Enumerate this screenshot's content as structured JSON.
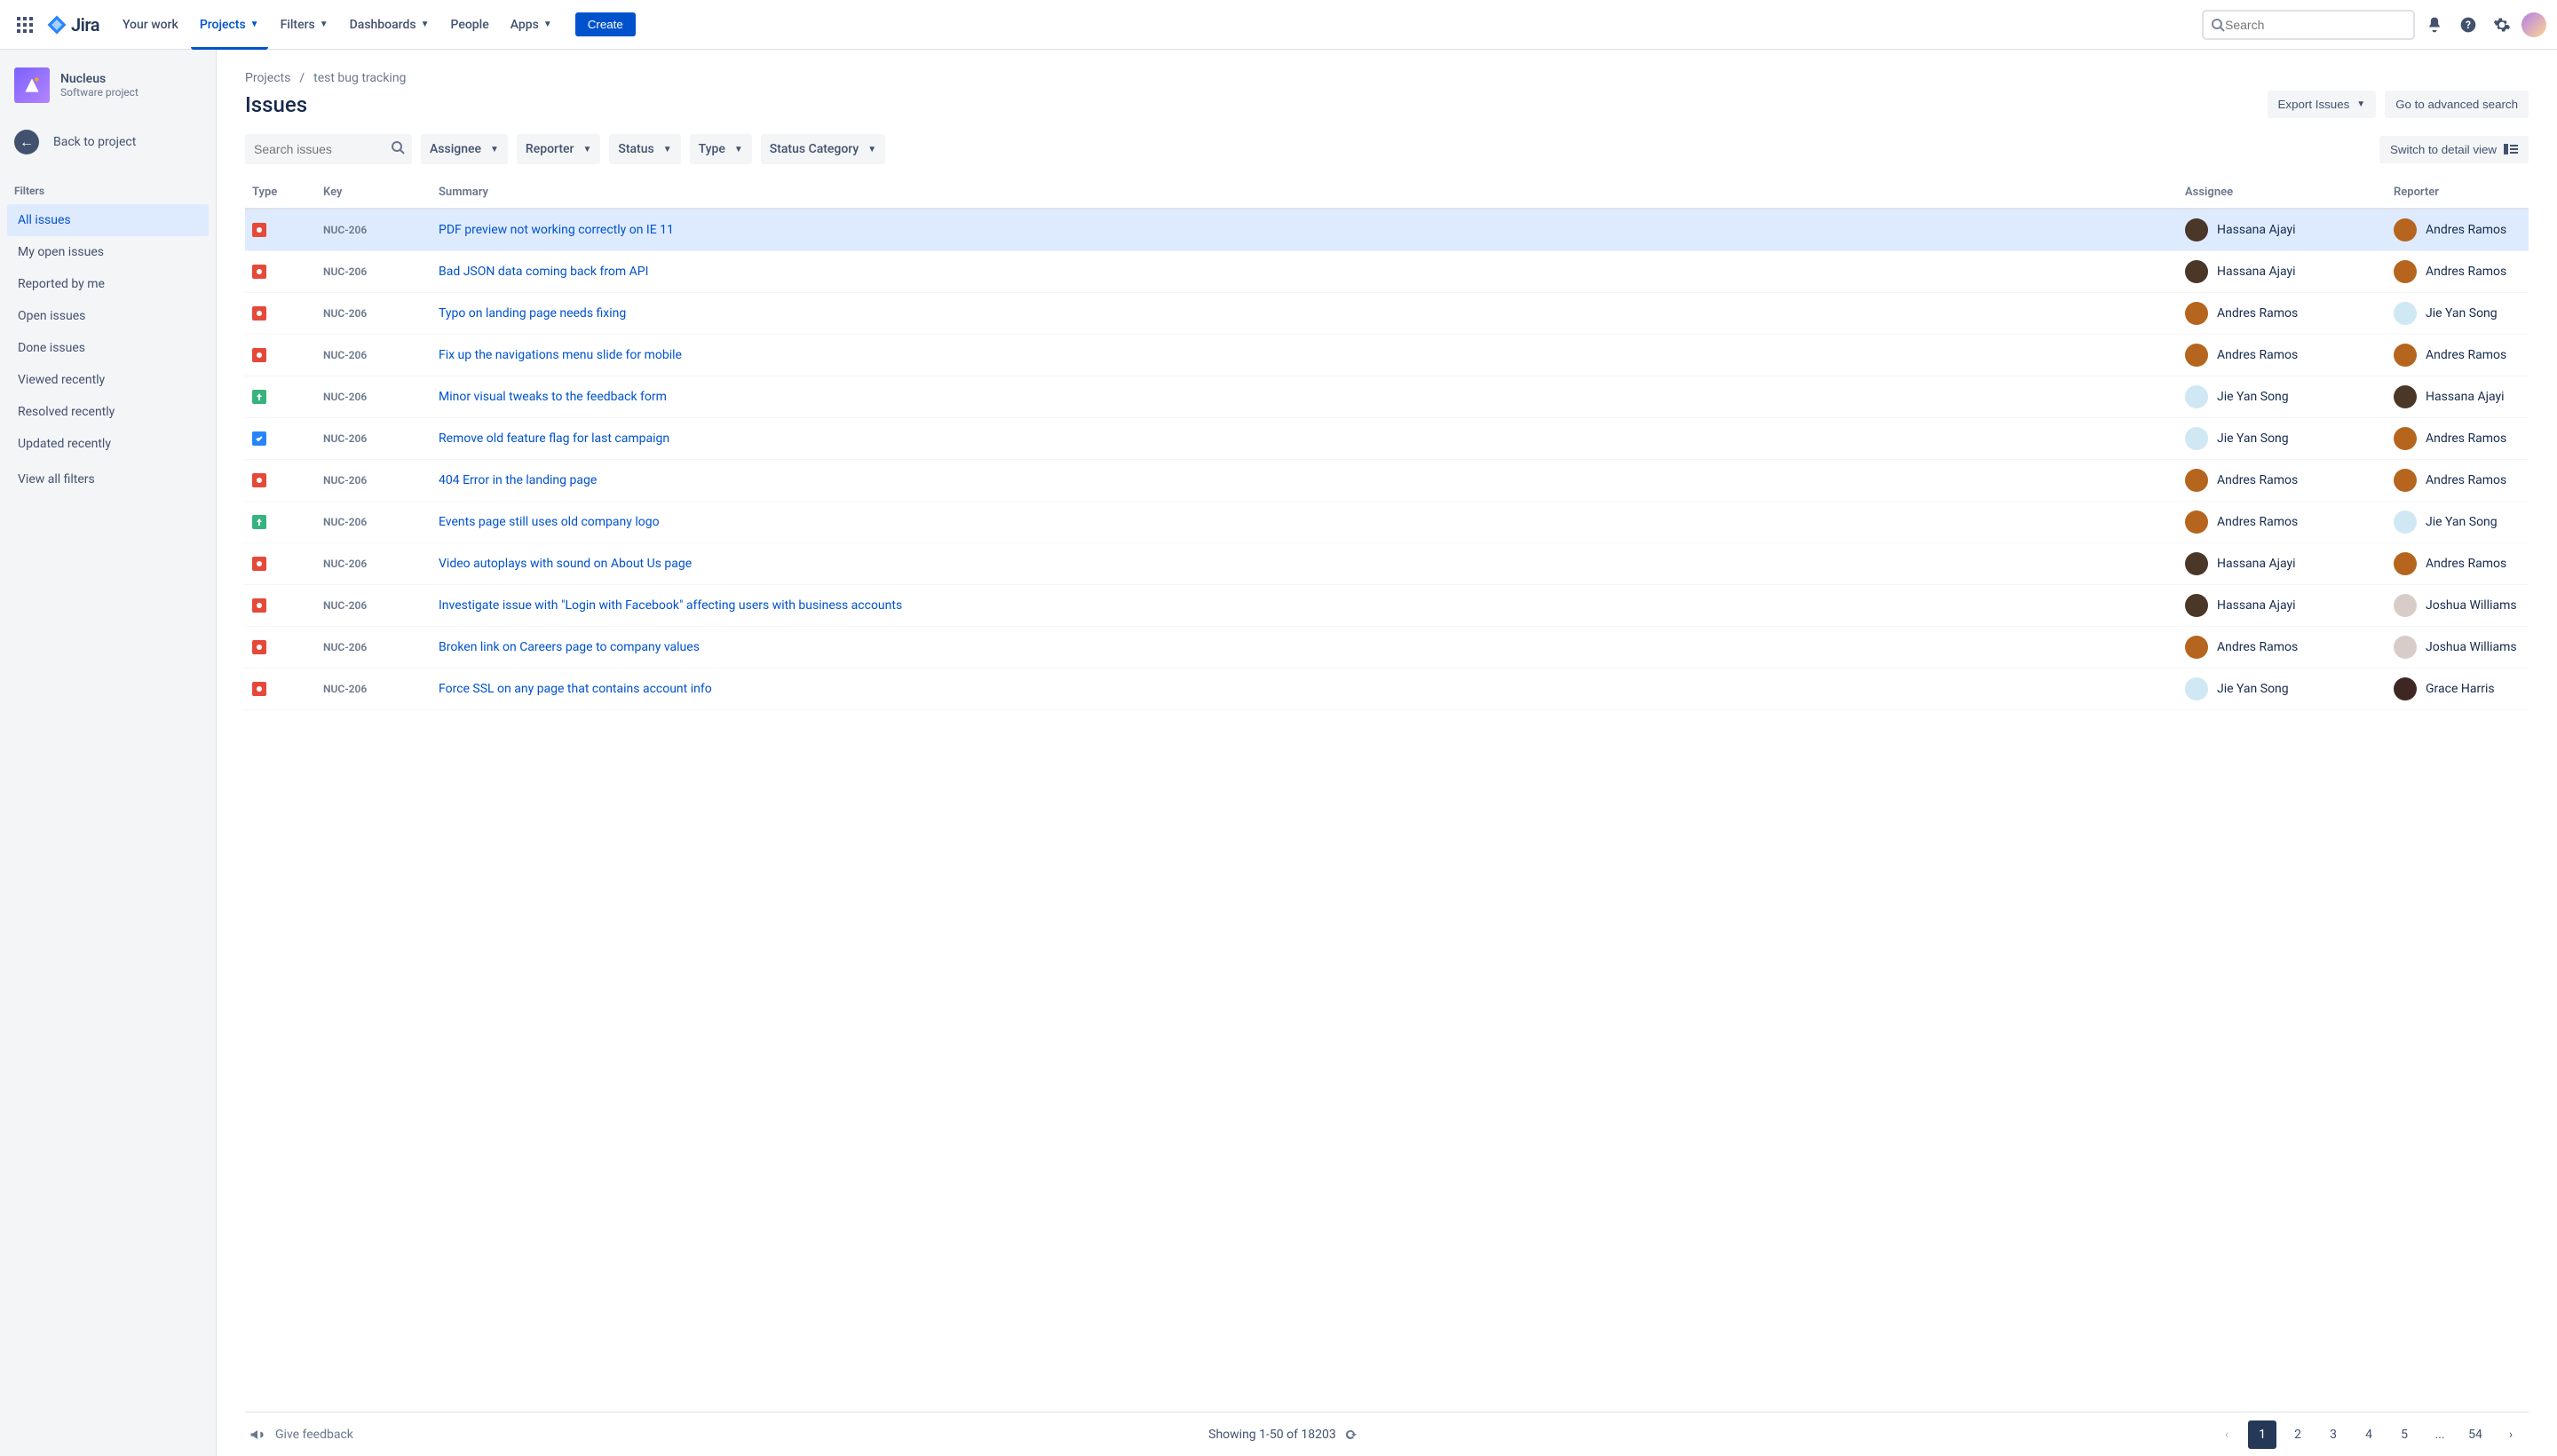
{
  "topnav": {
    "items": [
      {
        "label": "Your work",
        "dropdown": false
      },
      {
        "label": "Projects",
        "dropdown": true,
        "active": true
      },
      {
        "label": "Filters",
        "dropdown": true
      },
      {
        "label": "Dashboards",
        "dropdown": true
      },
      {
        "label": "People",
        "dropdown": false
      },
      {
        "label": "Apps",
        "dropdown": true
      }
    ],
    "create_label": "Create",
    "search_placeholder": "Search",
    "logo_text": "Jira"
  },
  "sidebar": {
    "project_name": "Nucleus",
    "project_sub": "Software project",
    "back_label": "Back to project",
    "filters_heading": "Filters",
    "filters": [
      {
        "label": "All issues",
        "active": true
      },
      {
        "label": "My open issues"
      },
      {
        "label": "Reported by me"
      },
      {
        "label": "Open issues"
      },
      {
        "label": "Done issues"
      },
      {
        "label": "Viewed recently"
      },
      {
        "label": "Resolved recently"
      },
      {
        "label": "Updated recently"
      }
    ],
    "view_all": "View all filters"
  },
  "breadcrumb": {
    "project": "Projects",
    "name": "test bug tracking"
  },
  "page_title": "Issues",
  "header_actions": {
    "export": "Export Issues",
    "advanced": "Go to advanced search"
  },
  "toolbar": {
    "search_placeholder": "Search issues",
    "chips": [
      "Assignee",
      "Reporter",
      "Status",
      "Type",
      "Status Category"
    ],
    "switch_view": "Switch to detail view"
  },
  "columns": {
    "type": "Type",
    "key": "Key",
    "summary": "Summary",
    "assignee": "Assignee",
    "reporter": "Reporter"
  },
  "avatars": {
    "Hassana Ajayi": "#4a3728",
    "Andres Ramos": "#b5651d",
    "Jie Yan Song": "#cfe8f3",
    "Joshua Williams": "#d7ccc8",
    "Grace Harris": "#3e2723"
  },
  "issues": [
    {
      "type": "bug",
      "key": "NUC-206",
      "summary": "PDF preview not working correctly on IE 11",
      "assignee": "Hassana Ajayi",
      "reporter": "Andres Ramos",
      "highlight": true
    },
    {
      "type": "bug",
      "key": "NUC-206",
      "summary": "Bad JSON data coming back from API",
      "assignee": "Hassana Ajayi",
      "reporter": "Andres Ramos"
    },
    {
      "type": "bug",
      "key": "NUC-206",
      "summary": "Typo on landing page needs fixing",
      "assignee": "Andres Ramos",
      "reporter": "Jie Yan Song"
    },
    {
      "type": "bug",
      "key": "NUC-206",
      "summary": "Fix up the navigations menu slide for mobile",
      "assignee": "Andres Ramos",
      "reporter": "Andres Ramos"
    },
    {
      "type": "imp",
      "key": "NUC-206",
      "summary": "Minor visual tweaks to the feedback form",
      "assignee": "Jie Yan Song",
      "reporter": "Hassana Ajayi"
    },
    {
      "type": "task",
      "key": "NUC-206",
      "summary": "Remove old feature flag for last campaign",
      "assignee": "Jie Yan Song",
      "reporter": "Andres Ramos"
    },
    {
      "type": "bug",
      "key": "NUC-206",
      "summary": "404 Error in the landing page",
      "assignee": "Andres Ramos",
      "reporter": "Andres Ramos"
    },
    {
      "type": "imp",
      "key": "NUC-206",
      "summary": "Events page still uses old company logo",
      "assignee": "Andres Ramos",
      "reporter": "Jie Yan Song"
    },
    {
      "type": "bug",
      "key": "NUC-206",
      "summary": "Video autoplays with sound on About Us page",
      "assignee": "Hassana Ajayi",
      "reporter": "Andres Ramos"
    },
    {
      "type": "bug",
      "key": "NUC-206",
      "summary": "Investigate issue with \"Login with Facebook\" affecting users with business accounts",
      "assignee": "Hassana Ajayi",
      "reporter": "Joshua Williams"
    },
    {
      "type": "bug",
      "key": "NUC-206",
      "summary": "Broken link on Careers page to company values",
      "assignee": "Andres Ramos",
      "reporter": "Joshua Williams"
    },
    {
      "type": "bug",
      "key": "NUC-206",
      "summary": "Force SSL on any page that contains account info",
      "assignee": "Jie Yan Song",
      "reporter": "Grace Harris"
    }
  ],
  "footer": {
    "feedback": "Give feedback",
    "showing": "Showing 1-50 of 18203",
    "pages": [
      "1",
      "2",
      "3",
      "4",
      "5",
      "...",
      "54"
    ]
  }
}
